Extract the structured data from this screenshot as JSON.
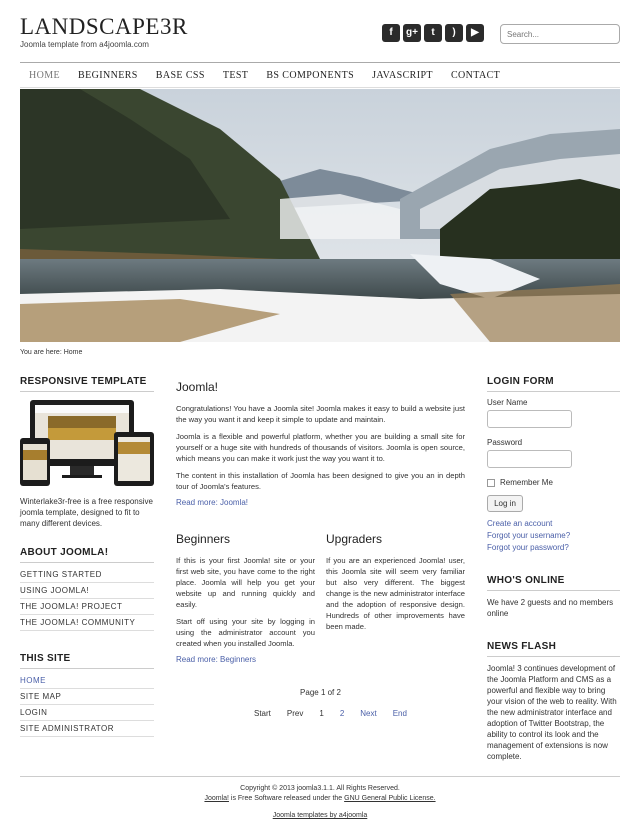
{
  "site": {
    "title": "LANDSCAPE3R",
    "tagline": "Joomla template from a4joomla.com"
  },
  "social": [
    {
      "icon": "facebook-icon",
      "glyph": "f"
    },
    {
      "icon": "google-plus-icon",
      "glyph": "g+"
    },
    {
      "icon": "twitter-icon",
      "glyph": "t"
    },
    {
      "icon": "rss-icon",
      "glyph": ")"
    },
    {
      "icon": "youtube-icon",
      "glyph": "▶"
    }
  ],
  "search": {
    "placeholder": "Search..."
  },
  "menu": [
    "HOME",
    "BEGINNERS",
    "BASE CSS",
    "TEST",
    "BS COMPONENTS",
    "JAVASCRIPT",
    "CONTACT"
  ],
  "breadcrumb": "You are here:  Home",
  "left": {
    "responsive_title": "RESPONSIVE TEMPLATE",
    "responsive_text": "Winterlake3r-free is a free responsive joomla template, designed to fit to many different devices.",
    "about_title": "ABOUT JOOMLA!",
    "about_items": [
      "GETTING STARTED",
      "USING JOOMLA!",
      "THE JOOMLA! PROJECT",
      "THE JOOMLA! COMMUNITY"
    ],
    "site_title": "THIS SITE",
    "site_items": [
      "HOME",
      "SITE MAP",
      "LOGIN",
      "SITE ADMINISTRATOR"
    ]
  },
  "main": {
    "joomla_title": "Joomla!",
    "joomla_p1": "Congratulations! You have a Joomla site! Joomla makes it easy to build a website just the way you want it and keep it simple to update and maintain.",
    "joomla_p2": "Joomla is a flexible and powerful platform, whether you are building a small site for yourself or a huge site with hundreds of thousands of visitors. Joomla is open source, which means you can make it work just the way you want it to.",
    "joomla_p3": "The content in this installation of Joomla has been designed to give you an in depth tour of Joomla's features.",
    "joomla_readmore": "Read more: Joomla!",
    "beginners_title": "Beginners",
    "beginners_p1": "If this is your first Joomla! site or your first web site, you have come to the right place. Joomla will help you get your website up and running quickly and easily.",
    "beginners_p2": "Start off using your site by logging in using the administrator account you created when you installed Joomla.",
    "beginners_readmore": "Read more: Beginners",
    "upgraders_title": "Upgraders",
    "upgraders_p1": "If you are an experienced Joomla! user, this Joomla site will seem very familiar but also very different. The biggest change is the new administrator interface and the adoption of responsive design. Hundreds of other improvements have been made.",
    "page_count": "Page 1 of 2",
    "pagination": [
      "Start",
      "Prev",
      "1",
      "2",
      "Next",
      "End"
    ]
  },
  "right": {
    "login_title": "LOGIN FORM",
    "username_label": "User Name",
    "password_label": "Password",
    "remember_label": "Remember Me",
    "login_button": "Log in",
    "create_account": "Create an account",
    "forgot_username": "Forgot your username?",
    "forgot_password": "Forgot your password?",
    "online_title": "WHO'S ONLINE",
    "online_text": "We have 2 guests and no members online",
    "news_title": "NEWS FLASH",
    "news_text": "Joomla! 3 continues development of the Joomla Platform and CMS as a powerful and flexible way to bring your vision of the web to reality. With the new administrator interface and adoption of Twitter Bootstrap, the ability to control its look and the management of extensions is now complete."
  },
  "footer": {
    "copyright": "Copyright © 2013 joomla3.1.1. All Rights Reserved.",
    "joomla_link": "Joomla!",
    "license_middle": " is Free Software released under the ",
    "license_link": "GNU General Public License.",
    "credit": "Joomla templates by a4joomla"
  },
  "colors": {
    "link": "#4a5fa8",
    "text": "#333333",
    "icon_bg": "#2b2b2b"
  }
}
